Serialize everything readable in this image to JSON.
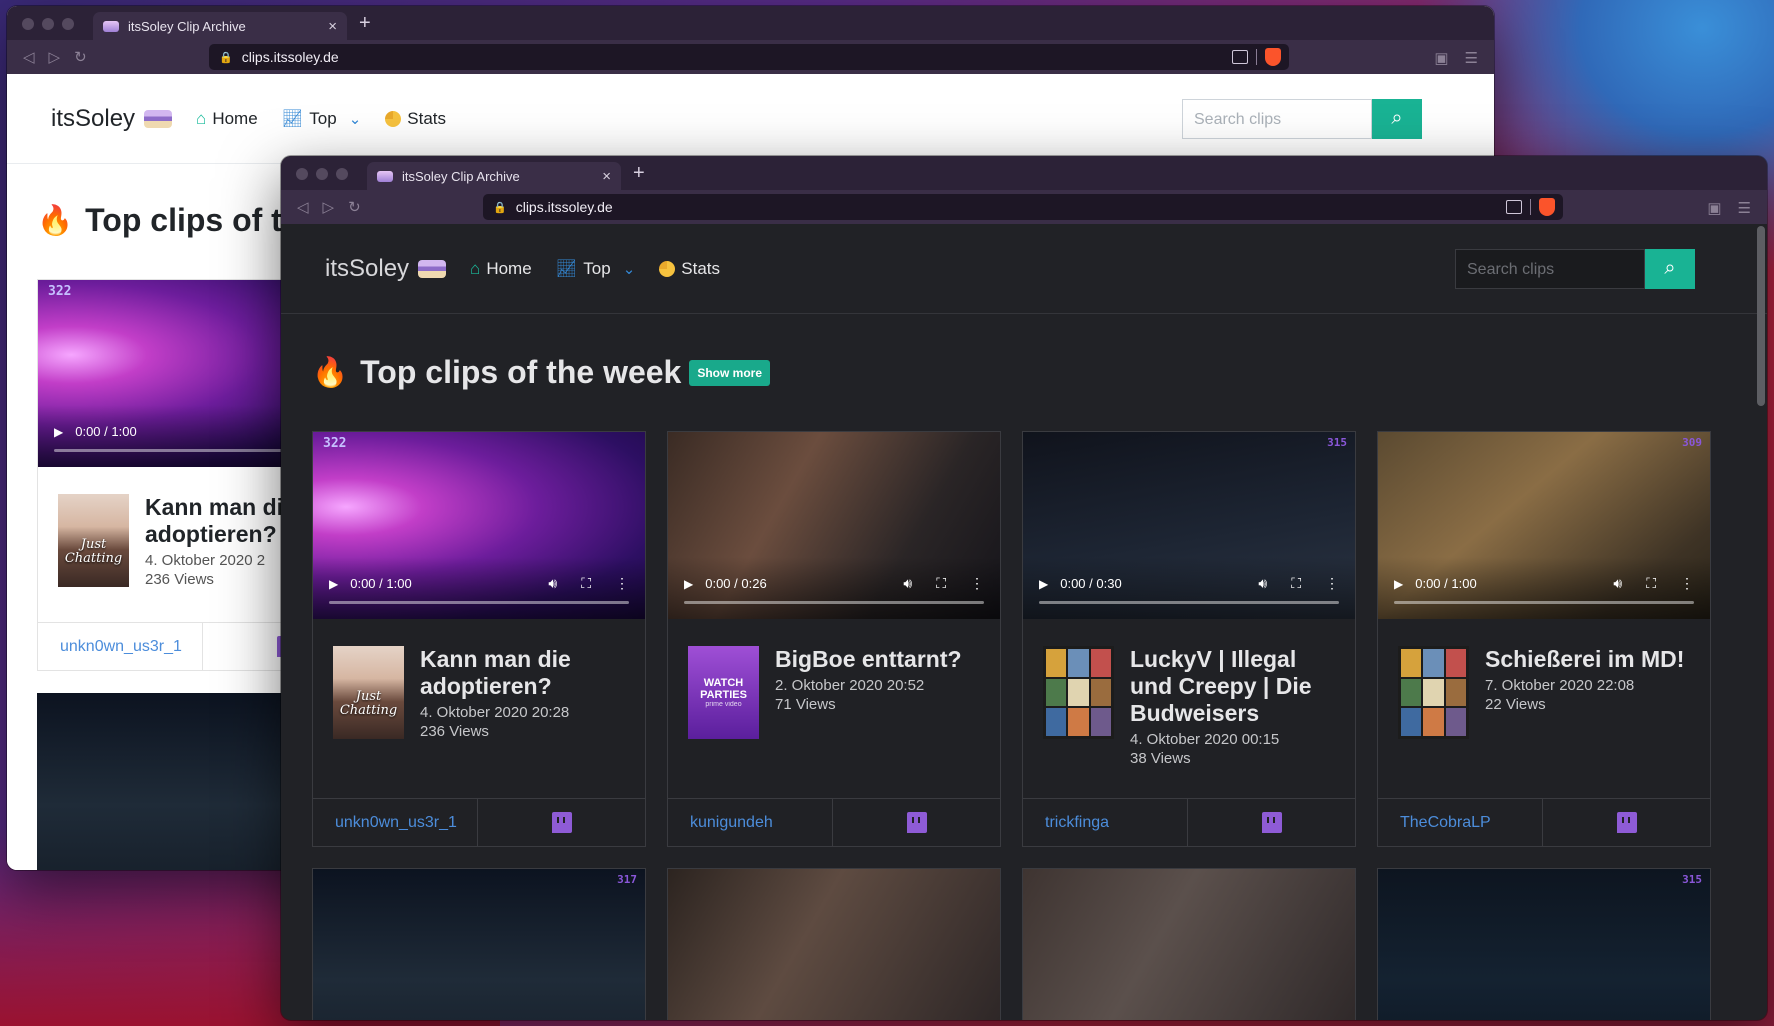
{
  "browser": {
    "tab_title": "itsSoley Clip Archive",
    "tab_close": "×",
    "new_tab": "+",
    "url": "clips.itssoley.de"
  },
  "site": {
    "brand": "itsSoley",
    "nav": {
      "home": "Home",
      "top": "Top",
      "stats": "Stats"
    },
    "search_placeholder": "Search clips",
    "section_title": "Top clips of the week",
    "section_title_partial": "Top clips of th",
    "show_more": "Show more"
  },
  "clips": [
    {
      "rank": "322",
      "time": "0:00 / 1:00",
      "title": "Kann man die adoptieren?",
      "title_partial": "Kann man di",
      "title_partial2": "adoptieren?",
      "date": "4. Oktober 2020 20:28",
      "date_partial": "4. Oktober 2020 2",
      "views": "236 Views",
      "user": "unkn0wn_us3r_1",
      "thumb": "Just Chatting",
      "thumb_colors": "#e5d3c7"
    },
    {
      "rank": "",
      "time": "0:00 / 0:26",
      "title": "BigBoe enttarnt?",
      "date": "2. Oktober 2020 20:52",
      "views": "71 Views",
      "user": "kunigundeh",
      "thumb": "WATCH PARTIES",
      "thumb_sub": "prime video"
    },
    {
      "rank": "315",
      "time": "0:00 / 0:30",
      "title": "LuckyV | Illegal und Creepy | Die Budweisers",
      "date": "4. Oktober 2020 00:15",
      "views": "38 Views",
      "user": "trickfinga",
      "thumb": "gta-cover-icon"
    },
    {
      "rank": "309",
      "time": "0:00 / 1:00",
      "title": "Schießerei im MD!",
      "date": "7. Oktober 2020 22:08",
      "views": "22 Views",
      "user": "TheCobraLP",
      "thumb": "gta-cover-icon"
    }
  ],
  "second_row_ranks": {
    "first": "317",
    "fourth": "315"
  },
  "colors": {
    "accent": "#19b394",
    "link": "#4c8ddb",
    "twitch": "#8e5bd6",
    "dark_bg": "#212226"
  }
}
